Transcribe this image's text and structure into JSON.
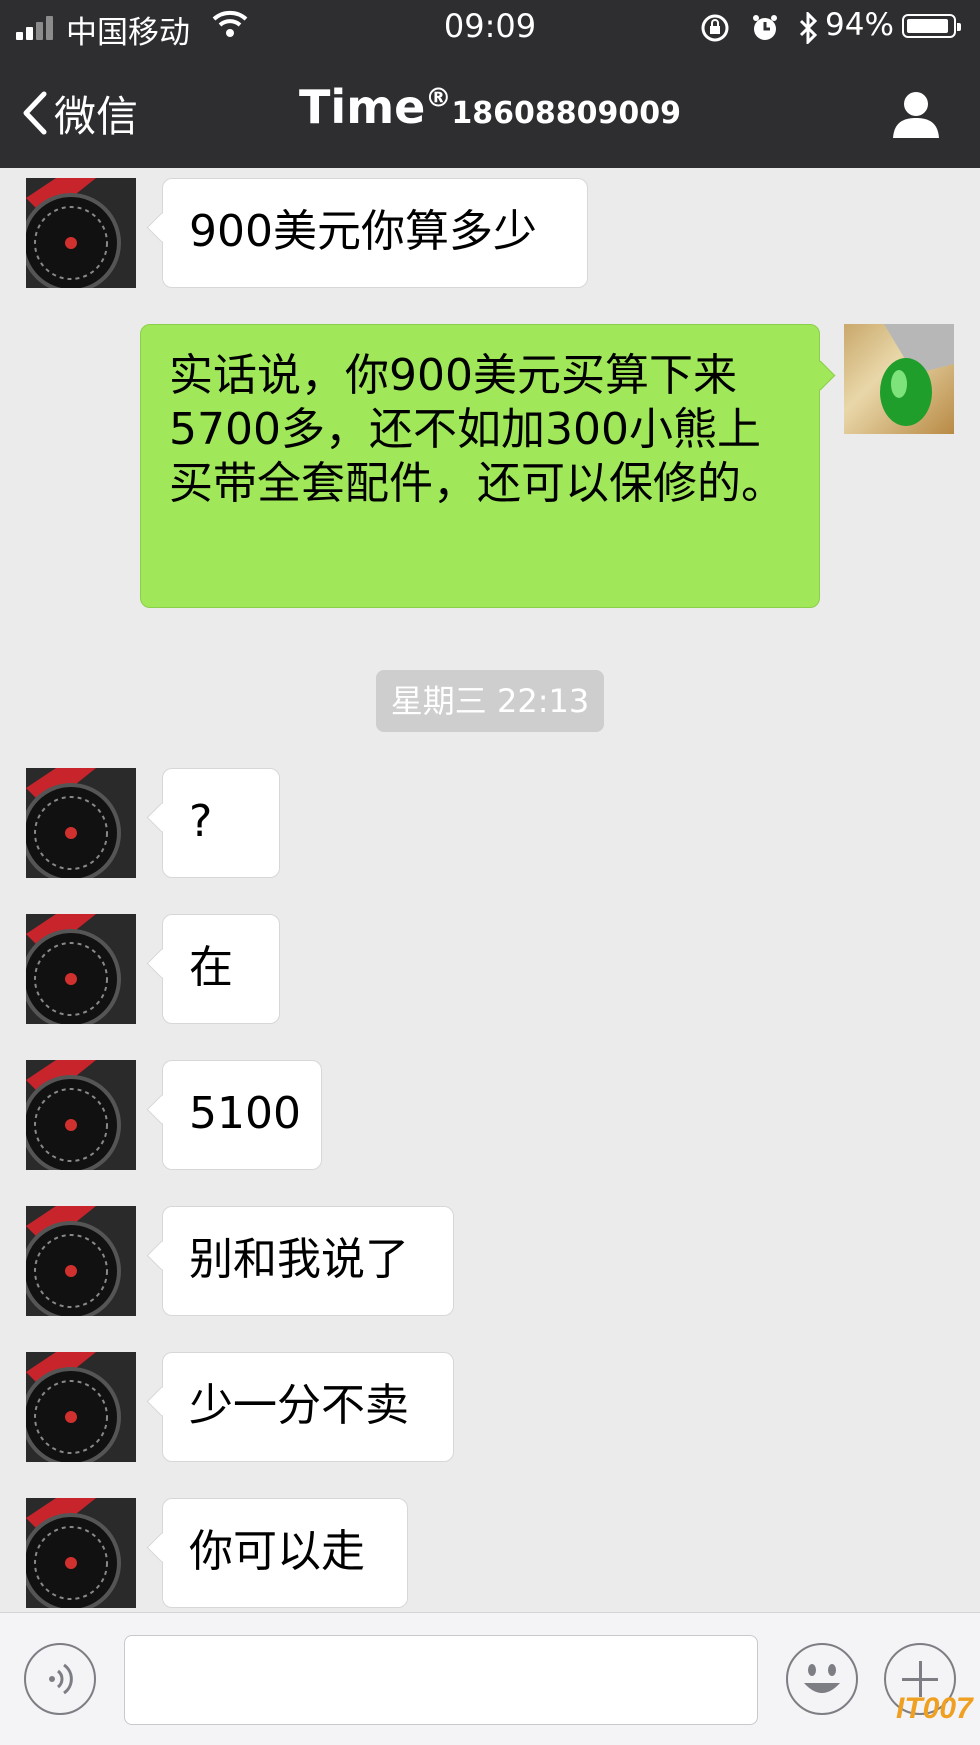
{
  "status_bar": {
    "carrier": "中国移动",
    "time": "09:09",
    "battery_percent": "94%",
    "battery_level": 0.94,
    "icons": [
      "signal-icon",
      "wifi-icon",
      "rotation-lock-icon",
      "alarm-icon",
      "bluetooth-icon",
      "battery-icon"
    ]
  },
  "nav": {
    "back_label": "微信",
    "title_name": "Time",
    "title_mark": "®",
    "title_number": "18608809009",
    "profile_icon": "person-icon"
  },
  "messages": [
    {
      "side": "left",
      "text": "900美元你算多少"
    },
    {
      "side": "right",
      "text": "实话说，你900美元买算下来5700多，还不如加300小熊上买带全套配件，还可以保修的。"
    },
    {
      "side": "left",
      "text": "?"
    },
    {
      "side": "left",
      "text": "在"
    },
    {
      "side": "left",
      "text": "5100"
    },
    {
      "side": "left",
      "text": "别和我说了"
    },
    {
      "side": "left",
      "text": "少一分不卖"
    },
    {
      "side": "left",
      "text": "你可以走"
    }
  ],
  "timestamp": "星期三 22:13",
  "input_bar": {
    "voice_icon": "voice-icon",
    "emoji_icon": "emoji-icon",
    "plus_icon": "plus-icon",
    "text_value": ""
  },
  "watermark": "IT007",
  "colors": {
    "header_bg": "#2e2e31",
    "chat_bg": "#ebebeb",
    "sent_bubble": "#a0e75a",
    "received_bubble": "#ffffff"
  }
}
